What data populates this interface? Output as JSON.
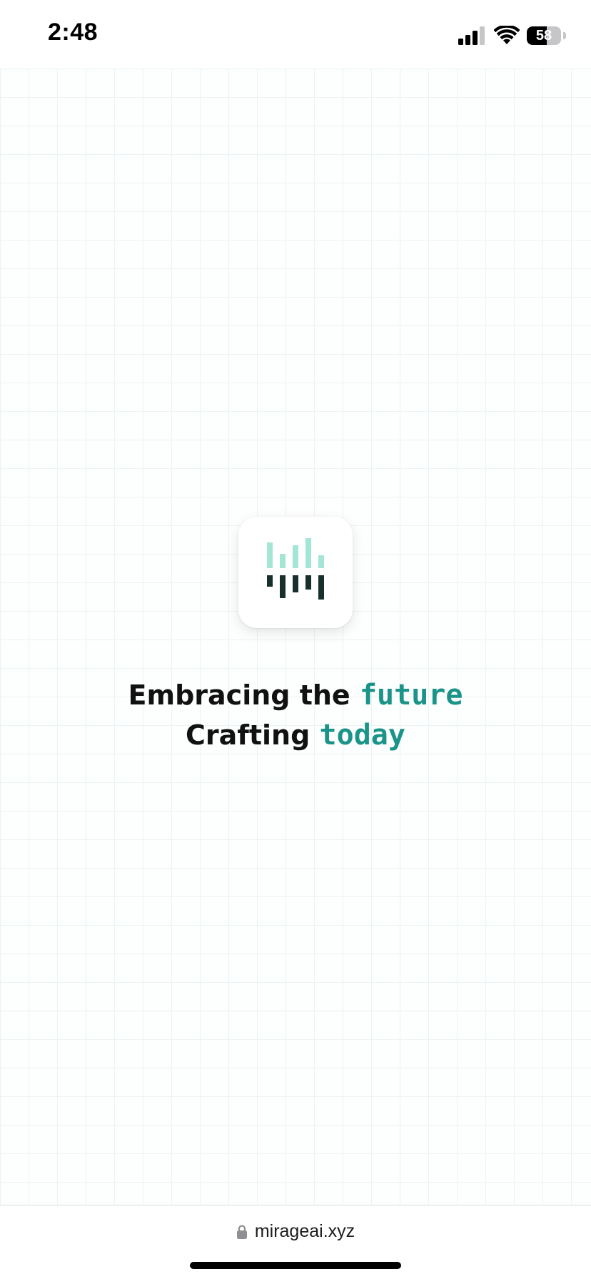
{
  "status_bar": {
    "time": "2:48",
    "battery_level": "58",
    "battery_fraction": 0.58,
    "signal_icon": "cellular-signal-icon",
    "wifi_icon": "wifi-icon"
  },
  "hero": {
    "logo_icon": "mirage-logo-icon",
    "line1_text": "Embracing the ",
    "line1_accent": "future",
    "line2_text": "Crafting ",
    "line2_accent": "today",
    "accent_color": "#1a9488",
    "logo_light_color": "#a4e6d6",
    "logo_dark_color": "#17302b"
  },
  "url_bar": {
    "lock_icon": "lock-icon",
    "url": "mirageai.xyz"
  }
}
